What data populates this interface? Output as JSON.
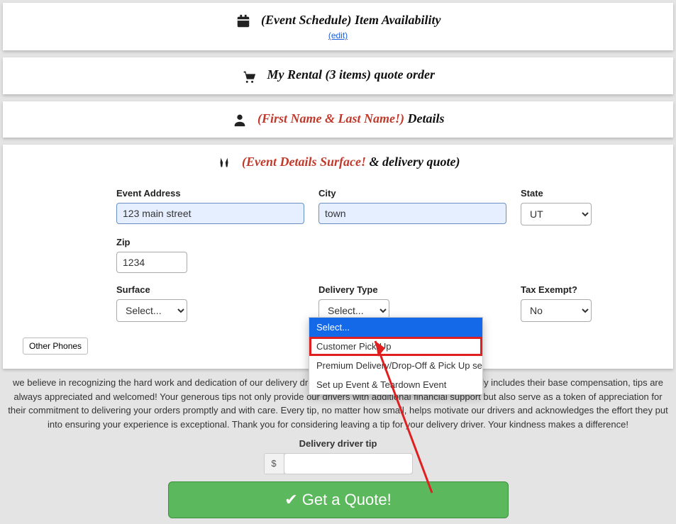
{
  "sections": {
    "availability": {
      "title_prefix": "(Event Schedule)",
      "title_rest": " Item Availability",
      "edit_link": "(edit)"
    },
    "rental": {
      "title_prefix": "My Rental ",
      "title_count": "(3 items)",
      "title_rest": " quote order"
    },
    "customer": {
      "title_prefix": "(First Name & Last Name!)",
      "title_rest": " Details"
    },
    "event": {
      "title_prefix": "(Event Details Surface!",
      "title_rest": " & delivery quote)"
    }
  },
  "form": {
    "address": {
      "label": "Event Address",
      "value": "123 main street"
    },
    "city": {
      "label": "City",
      "value": "town"
    },
    "state": {
      "label": "State",
      "value": "UT"
    },
    "zip": {
      "label": "Zip",
      "value": "1234"
    },
    "surface": {
      "label": "Surface",
      "value": "Select..."
    },
    "delivery": {
      "label": "Delivery Type",
      "value": "Select...",
      "options": [
        "Select...",
        "Customer Pick-Up",
        "Premium Delivery/Drop-Off & Pick Up service",
        "Set up Event & Teardown Event"
      ]
    },
    "tax": {
      "label": "Tax Exempt?",
      "value": "No"
    },
    "other_phones": "Other Phones"
  },
  "tip": {
    "text": "we believe in recognizing the hard work and dedication of our delivery drivers. While the delivery fee you pay already includes their base compensation, tips are always appreciated and welcomed! Your generous tips not only provide our drivers with additional financial support but also serve as a token of appreciation for their commitment to delivering your orders promptly and with care. Every tip, no matter how small, helps motivate our drivers and acknowledges the effort they put into ensuring your experience is exceptional. Thank you for considering leaving a tip for your delivery driver. Your kindness makes a difference!",
    "label": "Delivery driver tip",
    "currency": "$"
  },
  "quote_button": "Get a Quote!"
}
